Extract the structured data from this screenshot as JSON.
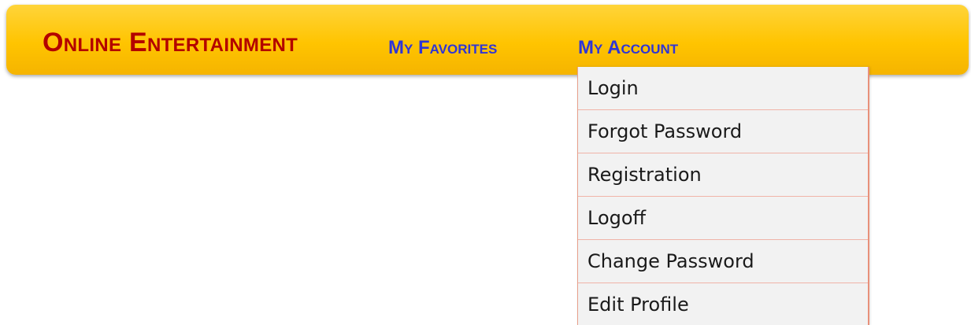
{
  "header": {
    "brand": "Online Entertainment",
    "nav": {
      "favorites": "My Favorites",
      "account": "My Account"
    }
  },
  "account_menu": {
    "items": [
      {
        "label": "Login"
      },
      {
        "label": "Forgot Password"
      },
      {
        "label": "Registration"
      },
      {
        "label": "Logoff"
      },
      {
        "label": "Change Password"
      },
      {
        "label": "Edit Profile"
      }
    ]
  },
  "colors": {
    "navbar_gradient_top": "#ffd43a",
    "navbar_gradient_bottom": "#f5b400",
    "brand_text": "#b30000",
    "nav_link_text": "#2f35d6",
    "menu_background": "#f2f2f2",
    "menu_border": "#e8907a"
  }
}
